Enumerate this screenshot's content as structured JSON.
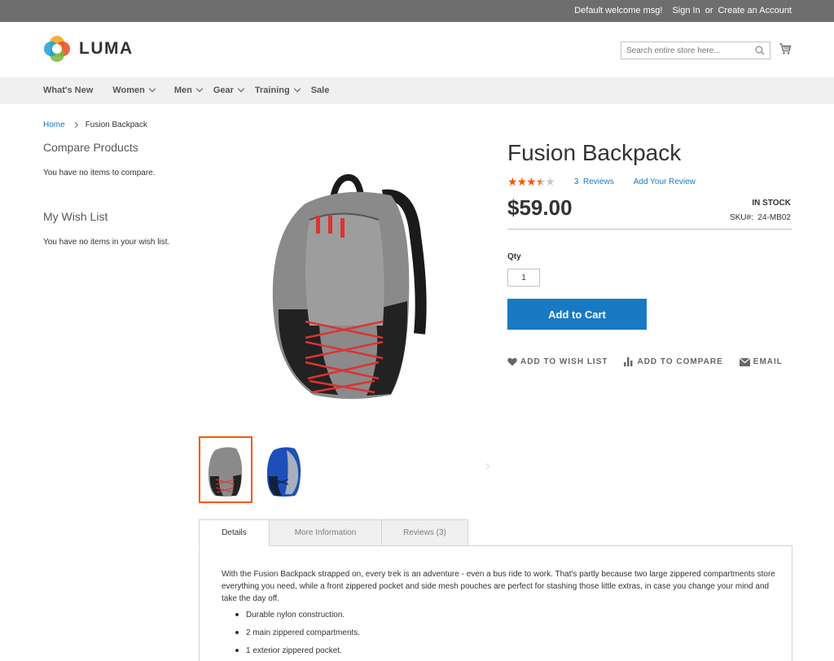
{
  "header": {
    "welcome": "Default welcome msg!",
    "sign_in": "Sign In",
    "or": "or",
    "create_account": "Create an Account",
    "logo_text": "LUMA",
    "search_placeholder": "Search entire store here...",
    "accent_color": "#1979c3",
    "topbar_color": "#6e6e6e"
  },
  "nav": {
    "items": [
      {
        "label": "What's New"
      },
      {
        "label": "Women"
      },
      {
        "label": "Men"
      },
      {
        "label": "Gear"
      },
      {
        "label": "Training"
      },
      {
        "label": "Sale"
      }
    ]
  },
  "breadcrumb": {
    "home": "Home",
    "current": "Fusion Backpack"
  },
  "sidebar": {
    "compare_title": "Compare Products",
    "compare_text": "You have no items to compare.",
    "wishlist_title": "My Wish List",
    "wishlist_text": "You have no items in your wish list."
  },
  "product": {
    "title": "Fusion Backpack",
    "rating": 3.5,
    "rating_max": 5,
    "reviews_count_label": "3",
    "reviews_word": "Reviews",
    "add_review": "Add Your Review",
    "price": "$59.00",
    "stock": "IN STOCK",
    "sku_label": "SKU#:",
    "sku": "24-MB02",
    "qty_label": "Qty",
    "qty_value": "1",
    "add_to_cart": "Add to Cart",
    "wishlist": "ADD TO WISH LIST",
    "compare": "ADD TO COMPARE",
    "email": "EMAIL"
  },
  "tabs": {
    "items": [
      {
        "label": "Details"
      },
      {
        "label": "More Information"
      },
      {
        "label": "Reviews (3)"
      }
    ],
    "description": "With the Fusion Backpack strapped on, every trek is an adventure - even a bus ride to work. That's partly because two large zippered compartments store everything you need, while a front zippered pocket and side mesh pouches are perfect for stashing those little extras, in case you change your mind and take the day off.",
    "bullets": [
      "Durable nylon construction.",
      "2 main zippered compartments.",
      "1 exterior zippered pocket."
    ]
  }
}
